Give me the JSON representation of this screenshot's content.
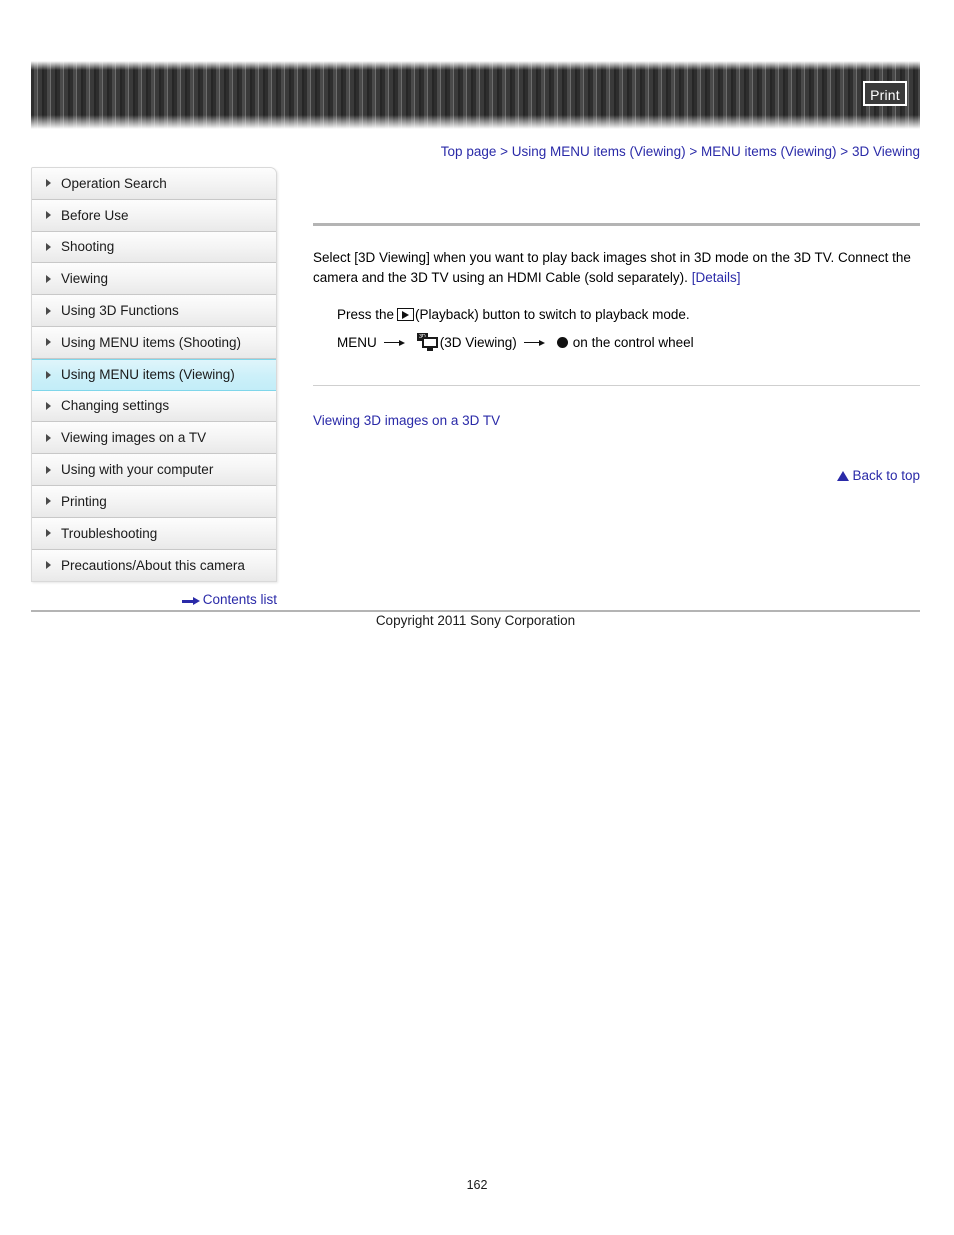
{
  "header": {
    "print_label": "Print"
  },
  "breadcrumb": {
    "separator": ">",
    "items": [
      {
        "label": "Top page"
      },
      {
        "label": "Using MENU items (Viewing)"
      },
      {
        "label": "MENU items (Viewing)"
      },
      {
        "label": "3D Viewing"
      }
    ]
  },
  "sidebar": {
    "items": [
      {
        "label": "Operation Search",
        "active": false
      },
      {
        "label": "Before Use",
        "active": false
      },
      {
        "label": "Shooting",
        "active": false
      },
      {
        "label": "Viewing",
        "active": false
      },
      {
        "label": "Using 3D Functions",
        "active": false
      },
      {
        "label": "Using MENU items (Shooting)",
        "active": false
      },
      {
        "label": "Using MENU items (Viewing)",
        "active": true
      },
      {
        "label": "Changing settings",
        "active": false
      },
      {
        "label": "Viewing images on a TV",
        "active": false
      },
      {
        "label": "Using with your computer",
        "active": false
      },
      {
        "label": "Printing",
        "active": false
      },
      {
        "label": "Troubleshooting",
        "active": false
      },
      {
        "label": "Precautions/About this camera",
        "active": false
      }
    ],
    "contents_list_label": "Contents list"
  },
  "content": {
    "paragraph_part1": "Select [3D Viewing] when you want to play back images shot in 3D mode on the 3D TV. Connect the camera and the 3D TV using an HDMI Cable (sold separately). ",
    "details_link": "[Details]",
    "step1_before_icon": "Press the ",
    "step1_after_icon": "(Playback) button to switch to playback mode.",
    "step2_menu": "MENU",
    "step2_label": "(3D Viewing)",
    "step2_tail": "on the control wheel",
    "tv3d_badge": "3D",
    "section_link": "Viewing 3D images on a 3D TV",
    "back_to_top": "Back to top"
  },
  "footer": {
    "copyright": "Copyright 2011 Sony Corporation",
    "page_number": "162"
  },
  "colors": {
    "link": "#2a2aa8",
    "active_nav_bg": "#ccf0f9",
    "active_nav_border": "#7fd6ea",
    "rule": "#b4b4b4"
  }
}
